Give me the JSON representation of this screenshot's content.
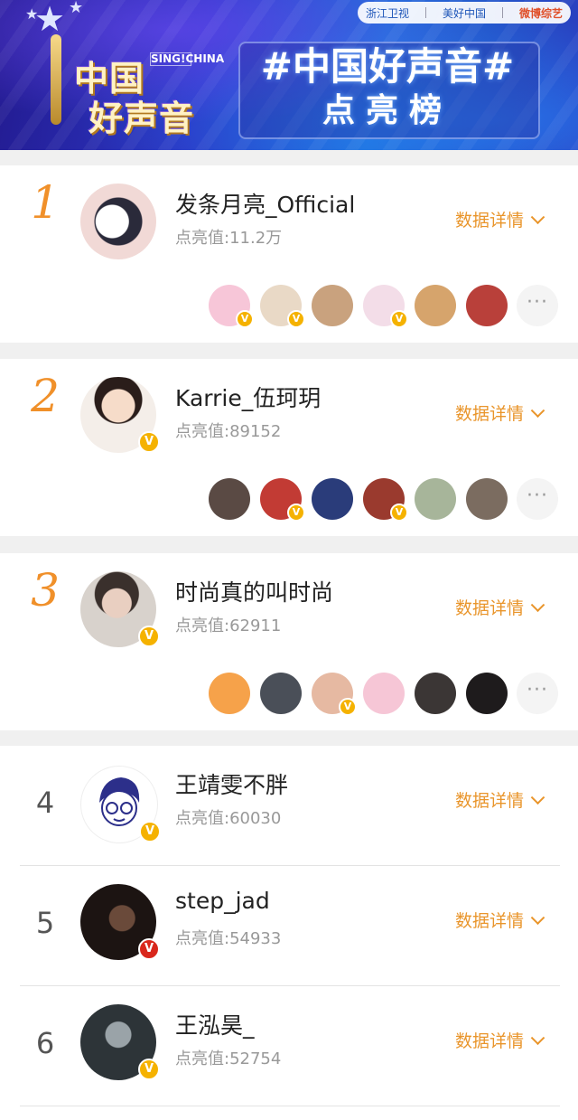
{
  "banner": {
    "partners": [
      "浙江卫视",
      "美好中国",
      "微博综艺"
    ],
    "logo_line1": "中国",
    "logo_line2": "好声音",
    "logo_sing": "SING!CHINA",
    "hashtag": "#中国好声音#",
    "subtitle": "点亮榜"
  },
  "detail_label": "数据详情",
  "score_prefix": "点亮值:",
  "more_icon": "···",
  "verified_glyph": "V",
  "ranking": [
    {
      "rank": "1",
      "name": "发条月亮_Official",
      "score": "点亮值:11.2万",
      "verified": false,
      "fans": [
        {
          "color": "#f7c6d8",
          "verified": true
        },
        {
          "color": "#e9d9c6",
          "verified": true
        },
        {
          "color": "#c9a27e",
          "verified": false
        },
        {
          "color": "#f3dde8",
          "verified": true
        },
        {
          "color": "#d6a46c",
          "verified": false
        },
        {
          "color": "#b9403a",
          "verified": false
        }
      ]
    },
    {
      "rank": "2",
      "name": "Karrie_伍珂玥",
      "score": "点亮值:89152",
      "verified": true,
      "fans": [
        {
          "color": "#5a4a44",
          "verified": false
        },
        {
          "color": "#c23b34",
          "verified": true
        },
        {
          "color": "#2a3c7a",
          "verified": false
        },
        {
          "color": "#9a3a2e",
          "verified": true
        },
        {
          "color": "#a7b59a",
          "verified": false
        },
        {
          "color": "#7b6c60",
          "verified": false
        }
      ]
    },
    {
      "rank": "3",
      "name": "时尚真的叫时尚",
      "score": "点亮值:62911",
      "verified": true,
      "fans": [
        {
          "color": "#f6a24a",
          "verified": false
        },
        {
          "color": "#4a4f58",
          "verified": false
        },
        {
          "color": "#e6b9a2",
          "verified": true
        },
        {
          "color": "#f6c6d6",
          "verified": false
        },
        {
          "color": "#3b3635",
          "verified": false
        },
        {
          "color": "#1e1b1c",
          "verified": false
        }
      ]
    },
    {
      "rank": "4",
      "name": "王靖雯不胖",
      "score": "点亮值:60030",
      "verified": true
    },
    {
      "rank": "5",
      "name": "step_jad",
      "score": "点亮值:54933",
      "verified": true,
      "badge": "red"
    },
    {
      "rank": "6",
      "name": "王泓昊_",
      "score": "点亮值:52754",
      "verified": true
    }
  ]
}
